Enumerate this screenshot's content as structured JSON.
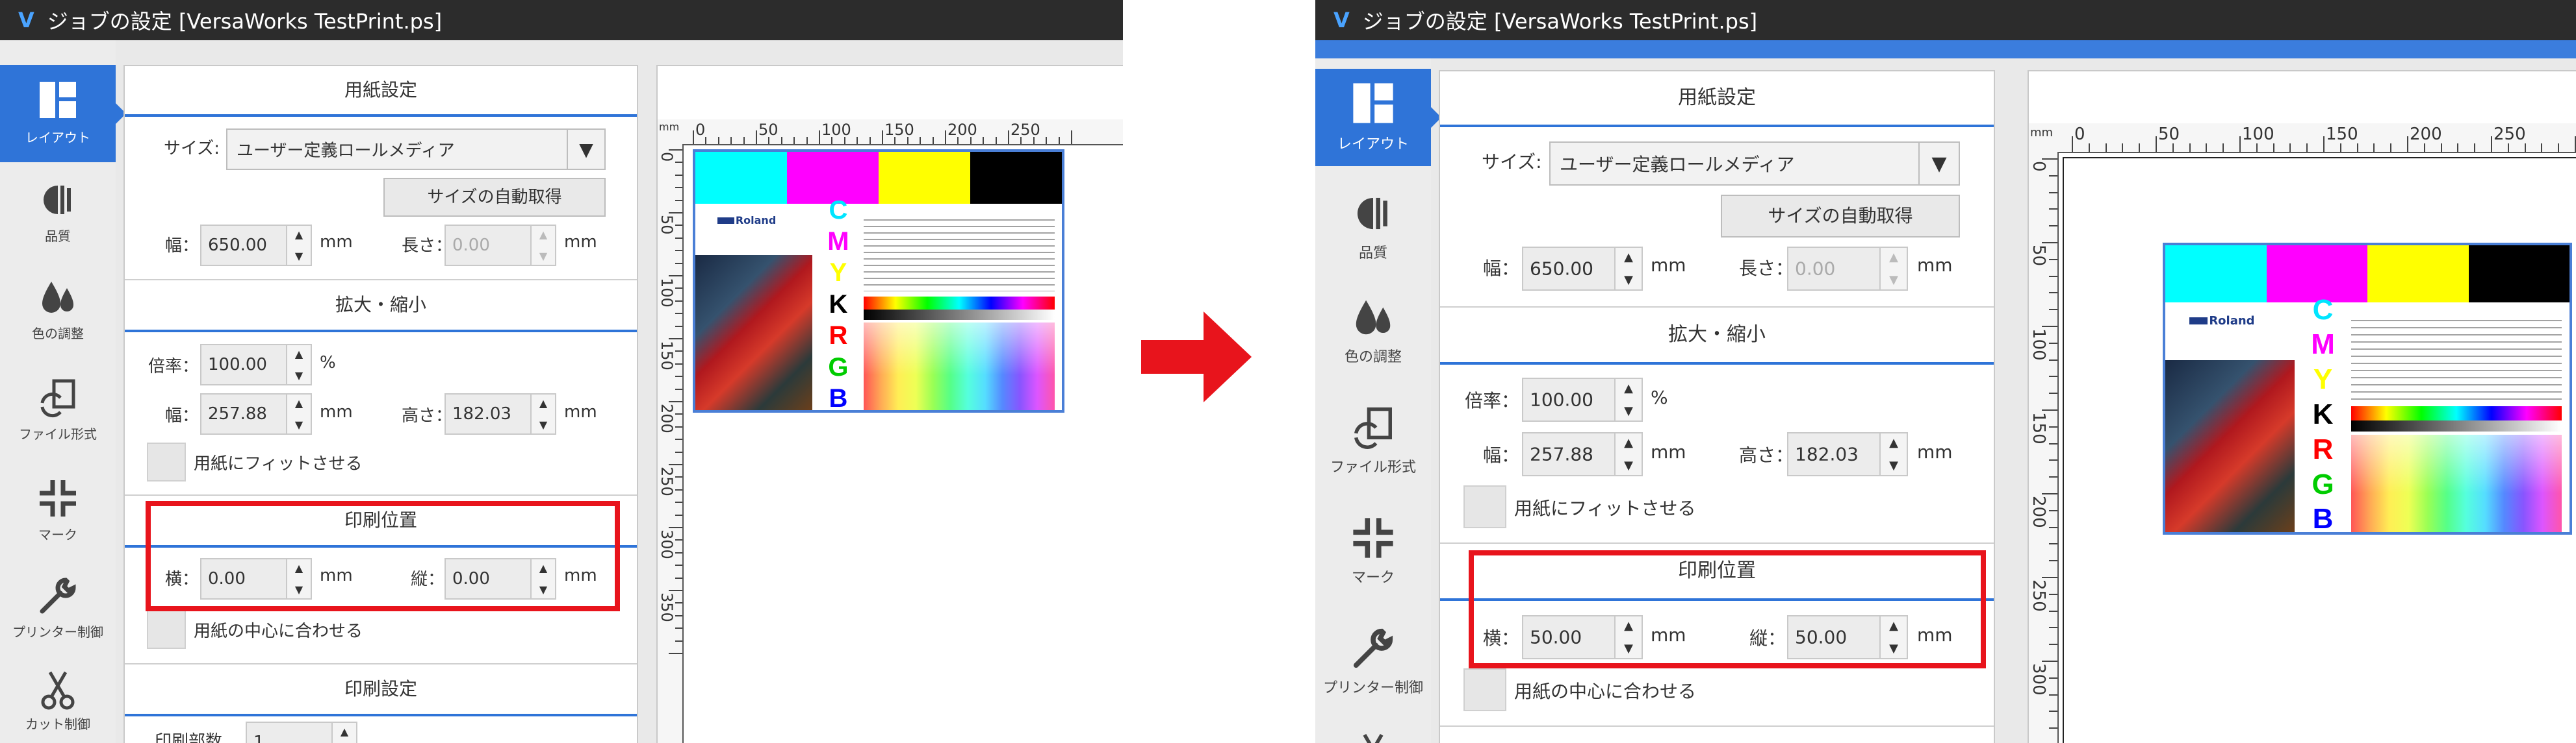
{
  "window": {
    "title": "ジョブの設定 [VersaWorks TestPrint.ps]"
  },
  "sidebar": {
    "items": [
      {
        "label": "レイアウト",
        "icon": "layout-icon"
      },
      {
        "label": "品質",
        "icon": "quality-icon"
      },
      {
        "label": "色の調整",
        "icon": "color-drops-icon"
      },
      {
        "label": "ファイル形式",
        "icon": "file-format-icon"
      },
      {
        "label": "マーク",
        "icon": "crop-marks-icon"
      },
      {
        "label": "プリンター制御",
        "icon": "wrench-icon"
      },
      {
        "label": "カット制御",
        "icon": "scissors-icon"
      }
    ]
  },
  "paper": {
    "header": "用紙設定",
    "size_label": "サイズ:",
    "size_value": "ユーザー定義ロールメディア",
    "auto_size_button": "サイズの自動取得",
    "width_label": "幅：",
    "width_value": "650.00",
    "length_label": "長さ：",
    "length_value": "0.00",
    "unit": "mm"
  },
  "scale": {
    "header": "拡大・縮小",
    "ratio_label": "倍率：",
    "ratio_value": "100.00",
    "percent": "%",
    "width_label": "幅：",
    "width_value": "257.88",
    "height_label": "高さ：",
    "height_value": "182.03",
    "unit": "mm",
    "fit_label": "用紙にフィットさせる"
  },
  "position": {
    "header": "印刷位置",
    "x_label": "横：",
    "y_label": "縦：",
    "unit": "mm",
    "center_label": "用紙の中心に合わせる"
  },
  "print_settings": {
    "header": "印刷設定",
    "copies_label": "印刷部数",
    "copies_value": "1"
  },
  "states": {
    "before": {
      "x_value": "0.00",
      "y_value": "0.00"
    },
    "after": {
      "x_value": "50.00",
      "y_value": "50.00"
    }
  },
  "ruler": {
    "unit": "mm",
    "top_labels": [
      "0",
      "50",
      "100",
      "150",
      "200",
      "250"
    ],
    "left_labels": [
      "0",
      "50",
      "100",
      "150",
      "200",
      "250",
      "300",
      "350"
    ]
  },
  "testprint": {
    "brand": "Roland",
    "letters": [
      "C",
      "M",
      "Y",
      "K",
      "R",
      "G",
      "B"
    ]
  },
  "colors": {
    "accent": "#2f74d8",
    "highlight": "#e8141c",
    "arrow": "#e8141c"
  }
}
